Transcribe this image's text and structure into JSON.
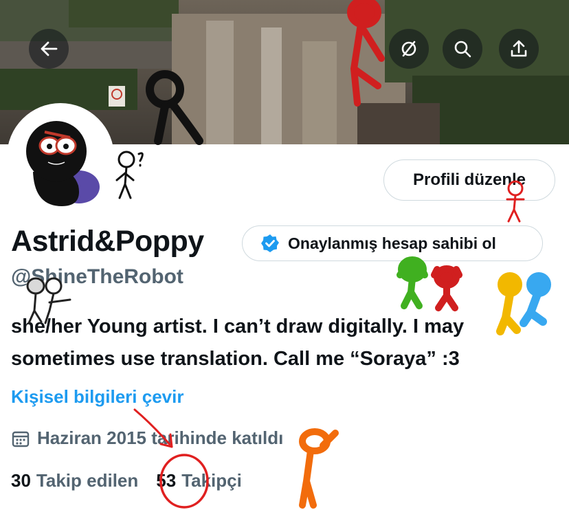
{
  "header": {
    "back_icon": "arrow-left-icon",
    "action_icons": [
      "hide-icon",
      "search-icon",
      "share-icon"
    ]
  },
  "profile": {
    "edit_label": "Profili düzenle",
    "display_name": "Astrid&Poppy",
    "verify_label": "Onaylanmış hesap sahibi ol",
    "handle": "@ShineTheRobot",
    "bio_line1": "she/her Young artist. I can’t draw digitally. I may",
    "bio_line2": "sometimes use translation. Call me “Soraya” :3",
    "translate_label": "Kişisel bilgileri çevir",
    "joined": "Haziran 2015 tarihinde katıldı"
  },
  "stats": {
    "following_count": "30",
    "following_label": "Takip edilen",
    "followers_count": "53",
    "followers_label": "Takipçi"
  },
  "colors": {
    "accent": "#1d9bf0",
    "secondary_text": "#536471",
    "border": "#cfd9de"
  }
}
